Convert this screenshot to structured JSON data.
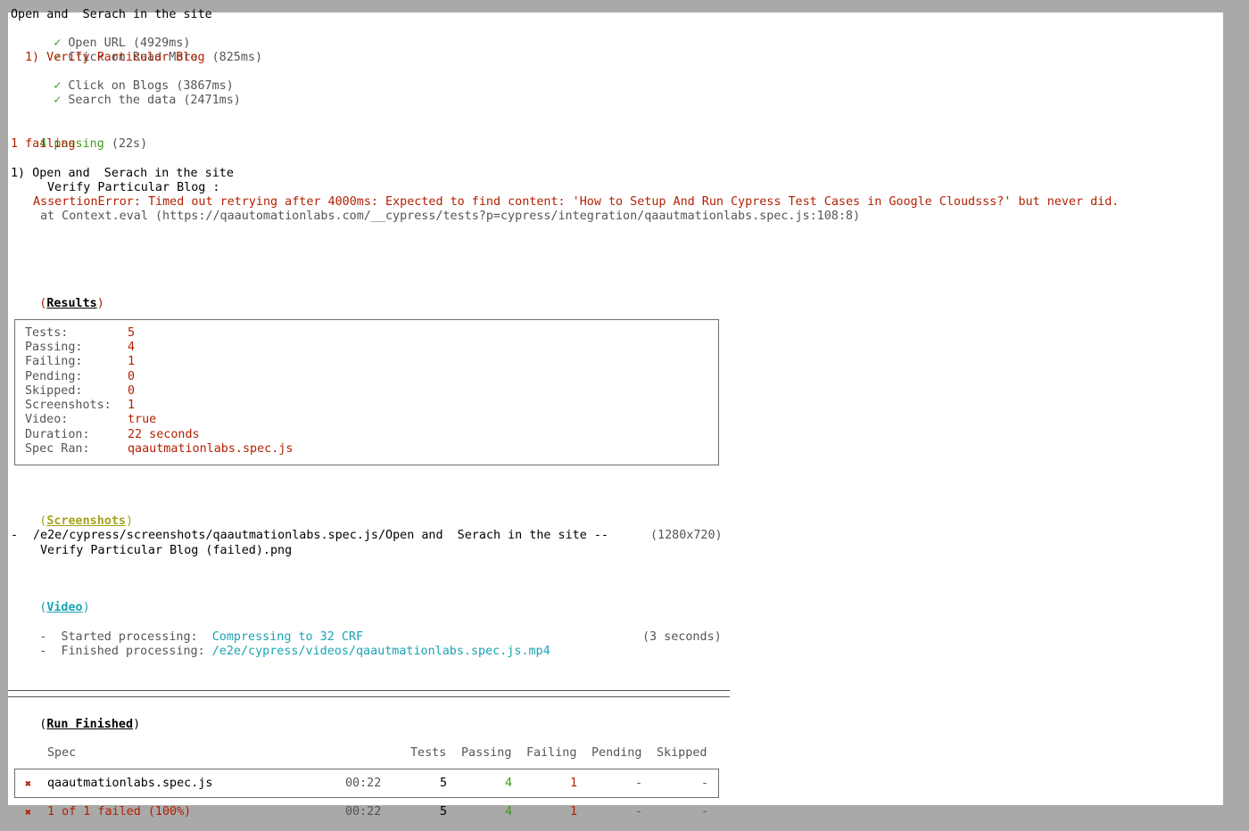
{
  "suite": {
    "title": "Open and  Serach in the site",
    "tests": [
      {
        "mark": "✓",
        "label": "Open URL",
        "time": "(4929ms)",
        "status": "pass"
      },
      {
        "mark": "✓",
        "label": "Click on Read More ",
        "time": "(825ms)",
        "status": "pass"
      },
      {
        "mark": "",
        "label": "1) Verify Particular Blog",
        "time": "",
        "status": "fail"
      },
      {
        "mark": "✓",
        "label": "Click on Blogs",
        "time": "(3867ms)",
        "status": "pass"
      },
      {
        "mark": "✓",
        "label": "Search the data",
        "time": "(2471ms)",
        "status": "pass"
      }
    ]
  },
  "summary": {
    "passing": "4 passing",
    "passing_time": "(22s)",
    "failing": "1 failing"
  },
  "failure": {
    "header": "1) Open and  Serach in the site",
    "test": "Verify Particular Blog :",
    "error": "AssertionError: Timed out retrying after 4000ms: Expected to find content: 'How to Setup And Run Cypress Test Cases in Google Cloudsss?' but never did.",
    "stack": "at Context.eval (https://qaautomationlabs.com/__cypress/tests?p=cypress/integration/qaautmationlabs.spec.js:108:8)"
  },
  "results": {
    "heading": "Results",
    "rows": [
      {
        "key": "Tests:",
        "value": "5"
      },
      {
        "key": "Passing:",
        "value": "4"
      },
      {
        "key": "Failing:",
        "value": "1"
      },
      {
        "key": "Pending:",
        "value": "0"
      },
      {
        "key": "Skipped:",
        "value": "0"
      },
      {
        "key": "Screenshots:",
        "value": "1"
      },
      {
        "key": "Video:",
        "value": "true"
      },
      {
        "key": "Duration:",
        "value": "22 seconds"
      },
      {
        "key": "Spec Ran:",
        "value": "qaautmationlabs.spec.js"
      }
    ]
  },
  "screenshots": {
    "heading": "Screenshots",
    "bullet": "-",
    "path_line1": "/e2e/cypress/screenshots/qaautmationlabs.spec.js/Open and  Serach in the site --",
    "path_line2": "Verify Particular Blog (failed).png",
    "size": "(1280x720)"
  },
  "video": {
    "heading": "Video",
    "started_label": "Started processing:",
    "started_value": "Compressing to 32 CRF",
    "finished_label": "Finished processing:",
    "finished_value": "/e2e/cypress/videos/qaautmationlabs.spec.js.mp4",
    "finished_time": "(3 seconds)"
  },
  "run_finished": {
    "heading": "Run Finished",
    "columns": [
      "Spec",
      "Tests",
      "Passing",
      "Failing",
      "Pending",
      "Skipped"
    ],
    "spec_row": {
      "mark": "✖",
      "spec": "qaautmationlabs.spec.js",
      "duration": "00:22",
      "tests": "5",
      "passing": "4",
      "failing": "1",
      "pending": "-",
      "skipped": "-"
    },
    "total_row": {
      "mark": "✖",
      "spec": "1 of 1 failed (100%)",
      "duration": "00:22",
      "tests": "5",
      "passing": "4",
      "failing": "1",
      "pending": "-",
      "skipped": "-"
    }
  },
  "colors": {
    "pass": "#3f9c1c",
    "fail": "#b31f00",
    "info": "#1aa3b3",
    "screenshots": "#a3a31d",
    "background": "#ffffff",
    "frame": "#a9a9a9"
  }
}
